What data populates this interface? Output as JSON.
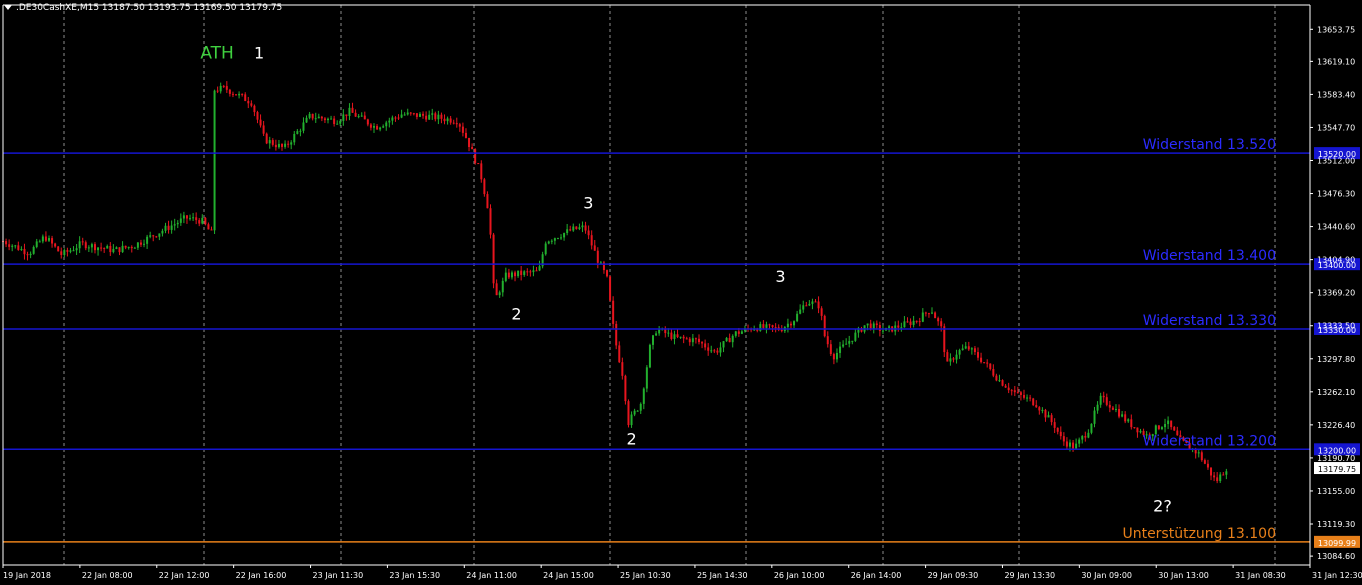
{
  "header": {
    "title": ".DE30CashXE,M15  13187.50 13193.75 13169.50 13179.75"
  },
  "colors": {
    "background": "#000000",
    "bull": "#22b02e",
    "bear": "#e8151e",
    "resistance": "#1515d0",
    "resistance_label": "#2b2bff",
    "support": "#e8801a",
    "grid": "#8c8c8c",
    "axis_text": "#ffffff",
    "ath": "#3fd13f",
    "annotation": "#ffffff"
  },
  "chart_data": {
    "type": "candlestick",
    "symbol": ".DE30CashXE",
    "timeframe": "M15",
    "ohlc": {
      "open": 13187.5,
      "high": 13193.75,
      "low": 13169.5,
      "close": 13179.75
    },
    "ylim": [
      13075,
      13680
    ],
    "y_ticks": [
      "13653.75",
      "13619.10",
      "13583.40",
      "13547.70",
      "13512.00",
      "13476.30",
      "13440.60",
      "13404.90",
      "13369.20",
      "13333.50",
      "13297.80",
      "13262.10",
      "13226.40",
      "13190.70",
      "13155.00",
      "13119.30",
      "13084.60"
    ],
    "x_labels": [
      "19 Jan 2018",
      "22 Jan 08:00",
      "22 Jan 12:00",
      "22 Jan 16:00",
      "23 Jan 11:30",
      "23 Jan 15:30",
      "24 Jan 11:00",
      "24 Jan 15:00",
      "25 Jan 10:30",
      "25 Jan 14:30",
      "26 Jan 10:00",
      "26 Jan 14:00",
      "29 Jan 09:30",
      "29 Jan 13:30",
      "30 Jan 09:00",
      "30 Jan 13:00",
      "31 Jan 08:30",
      "31 Jan 12:30"
    ],
    "current_price": "13179.75",
    "levels": [
      {
        "label": "Widerstand 13.520",
        "value": 13520,
        "kind": "resistance",
        "axis_tag": "13520.00"
      },
      {
        "label": "Widerstand 13.400",
        "value": 13400,
        "kind": "resistance",
        "axis_tag": "13400.00"
      },
      {
        "label": "Widerstand 13.330",
        "value": 13330,
        "kind": "resistance",
        "axis_tag": "13330.00"
      },
      {
        "label": "Widerstand 13.200",
        "value": 13200,
        "kind": "resistance",
        "axis_tag": "13200.00"
      },
      {
        "label": "Unterstützung 13.100",
        "value": 13100,
        "kind": "support",
        "axis_tag": "13099.99"
      }
    ],
    "annotations": [
      {
        "text": "ATH",
        "price": 13622,
        "style": "ath"
      },
      {
        "text": "1",
        "price": 13622,
        "style": "normal"
      },
      {
        "text": "2",
        "price": 13340,
        "style": "normal"
      },
      {
        "text": "3",
        "price": 13460,
        "style": "normal"
      },
      {
        "text": "2",
        "price": 13205,
        "style": "normal"
      },
      {
        "text": "3",
        "price": 13381,
        "style": "normal"
      },
      {
        "text": "2?",
        "price": 13133,
        "style": "normal"
      }
    ],
    "path": [
      [
        0,
        13425
      ],
      [
        0.008,
        13420
      ],
      [
        0.02,
        13412
      ],
      [
        0.032,
        13430
      ],
      [
        0.045,
        13410
      ],
      [
        0.06,
        13422
      ],
      [
        0.085,
        13415
      ],
      [
        0.1,
        13420
      ],
      [
        0.12,
        13435
      ],
      [
        0.14,
        13450
      ],
      [
        0.152,
        13447
      ],
      [
        0.16,
        13432
      ],
      [
        0.16,
        13588
      ],
      [
        0.17,
        13590
      ],
      [
        0.19,
        13575
      ],
      [
        0.2,
        13535
      ],
      [
        0.215,
        13525
      ],
      [
        0.235,
        13560
      ],
      [
        0.255,
        13555
      ],
      [
        0.265,
        13565
      ],
      [
        0.285,
        13548
      ],
      [
        0.305,
        13562
      ],
      [
        0.325,
        13560
      ],
      [
        0.348,
        13555
      ],
      [
        0.355,
        13535
      ],
      [
        0.365,
        13500
      ],
      [
        0.372,
        13455
      ],
      [
        0.376,
        13360
      ],
      [
        0.385,
        13388
      ],
      [
        0.41,
        13392
      ],
      [
        0.415,
        13425
      ],
      [
        0.435,
        13437
      ],
      [
        0.445,
        13440
      ],
      [
        0.455,
        13405
      ],
      [
        0.462,
        13385
      ],
      [
        0.468,
        13320
      ],
      [
        0.475,
        13275
      ],
      [
        0.478,
        13228
      ],
      [
        0.488,
        13250
      ],
      [
        0.495,
        13310
      ],
      [
        0.5,
        13330
      ],
      [
        0.515,
        13320
      ],
      [
        0.53,
        13318
      ],
      [
        0.545,
        13305
      ],
      [
        0.56,
        13325
      ],
      [
        0.575,
        13332
      ],
      [
        0.595,
        13330
      ],
      [
        0.605,
        13340
      ],
      [
        0.615,
        13360
      ],
      [
        0.625,
        13355
      ],
      [
        0.628,
        13325
      ],
      [
        0.635,
        13300
      ],
      [
        0.648,
        13318
      ],
      [
        0.66,
        13335
      ],
      [
        0.675,
        13328
      ],
      [
        0.69,
        13335
      ],
      [
        0.7,
        13340
      ],
      [
        0.71,
        13352
      ],
      [
        0.718,
        13330
      ],
      [
        0.722,
        13290
      ],
      [
        0.73,
        13305
      ],
      [
        0.738,
        13310
      ],
      [
        0.75,
        13295
      ],
      [
        0.762,
        13275
      ],
      [
        0.775,
        13260
      ],
      [
        0.79,
        13250
      ],
      [
        0.805,
        13225
      ],
      [
        0.81,
        13210
      ],
      [
        0.82,
        13202
      ],
      [
        0.83,
        13220
      ],
      [
        0.84,
        13255
      ],
      [
        0.85,
        13245
      ],
      [
        0.86,
        13230
      ],
      [
        0.875,
        13215
      ],
      [
        0.89,
        13230
      ],
      [
        0.9,
        13210
      ],
      [
        0.915,
        13195
      ],
      [
        0.928,
        13165
      ],
      [
        0.936,
        13180
      ]
    ]
  }
}
